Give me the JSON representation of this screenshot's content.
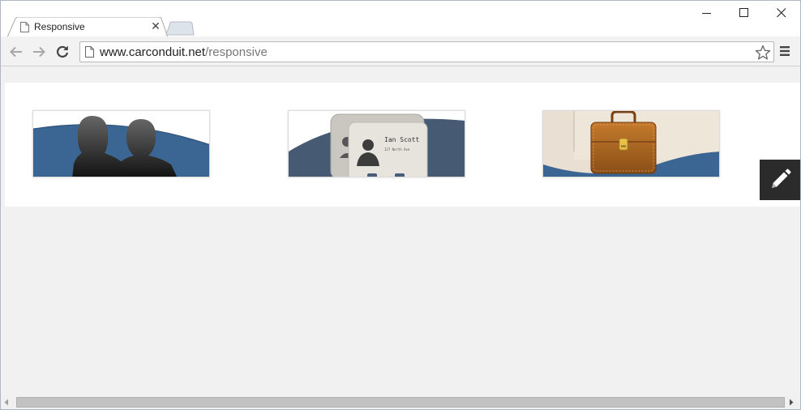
{
  "browser": {
    "tab": {
      "title": "Responsive",
      "favicon": "page-icon",
      "close_glyph": "✕"
    },
    "window_controls": [
      "minimize-icon",
      "maximize-icon",
      "close-icon"
    ],
    "toolbar": {
      "back": "back-arrow-icon",
      "forward": "forward-arrow-icon",
      "reload": "reload-icon",
      "url_host": "www.carconduit.net",
      "url_path": "/responsive",
      "bookmark": "star-icon",
      "menu": "hamburger-menu-icon"
    }
  },
  "page": {
    "background": "#f1f1f1",
    "banner_background": "#ffffff",
    "accent_blue": "#3b6593",
    "thumbnails": [
      {
        "id": "people",
        "icon": "people-silhouettes-icon"
      },
      {
        "id": "contact-card",
        "icon": "contact-card-icon",
        "card_name": "Ian Scott",
        "card_address": "127 North Ave"
      },
      {
        "id": "briefcase",
        "icon": "briefcase-icon"
      }
    ],
    "edit_button": {
      "icon": "pencil-icon",
      "background": "#2b2b2b"
    }
  },
  "scrollbar": {
    "orientation": "horizontal"
  }
}
